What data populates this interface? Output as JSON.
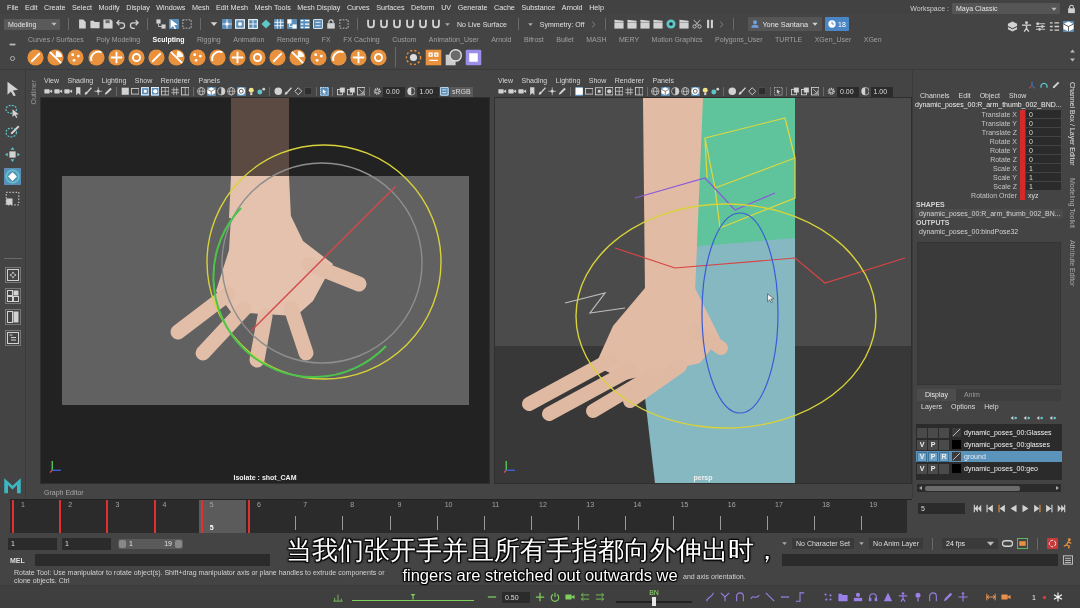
{
  "menu_bar": {
    "items": [
      "File",
      "Edit",
      "Create",
      "Select",
      "Modify",
      "Display",
      "Windows",
      "Mesh",
      "Edit Mesh",
      "Mesh Tools",
      "Mesh Display",
      "Curves",
      "Surfaces",
      "Deform",
      "UV",
      "Generate",
      "Cache",
      "Substance",
      "Arnold",
      "Help"
    ],
    "workspace_label": "Workspace :",
    "workspace": "Maya Classic"
  },
  "status_line": {
    "menu_set": "Modeling",
    "buttons": [
      {
        "on": false
      },
      {
        "on": false
      },
      {
        "on": false
      },
      {
        "on": false
      },
      {
        "on": false
      },
      {
        "on": false
      },
      {
        "on": true
      },
      {
        "on": false
      },
      {
        "on": true
      },
      {
        "on": true
      },
      {
        "on": true
      },
      {
        "on": false
      },
      {
        "on": true
      },
      {
        "on": true
      },
      {
        "on": true
      },
      {
        "on": true
      },
      {
        "on": false
      },
      {
        "on": false
      },
      {
        "on": false
      },
      {
        "on": false
      },
      {
        "on": false
      },
      {
        "on": false
      },
      {
        "on": false
      },
      {
        "on": false
      }
    ],
    "live_surface": "No Live Surface",
    "symmetry": "Symmetry: Off",
    "user": "Yone Santana",
    "notifications": "18",
    "panel_buttons": [
      {
        "on": false
      },
      {
        "on": false
      },
      {
        "on": false
      },
      {
        "on": false
      },
      {
        "on": true
      }
    ]
  },
  "shelf": {
    "tabs": [
      {
        "label": "Curves / Surfaces",
        "selected": false
      },
      {
        "label": "Poly Modeling",
        "selected": false
      },
      {
        "label": "Sculpting",
        "selected": true
      },
      {
        "label": "Rigging",
        "selected": false
      },
      {
        "label": "Animation",
        "selected": false
      },
      {
        "label": "Rendering",
        "selected": false
      },
      {
        "label": "FX",
        "selected": false
      },
      {
        "label": "FX Caching",
        "selected": false
      },
      {
        "label": "Custom",
        "selected": false
      },
      {
        "label": "Animation_User",
        "selected": false
      },
      {
        "label": "Arnold",
        "selected": false
      },
      {
        "label": "Bifrost",
        "selected": false
      },
      {
        "label": "Bullet",
        "selected": false
      },
      {
        "label": "MASH",
        "selected": false
      },
      {
        "label": "MERY",
        "selected": false
      },
      {
        "label": "Motion Graphics",
        "selected": false
      },
      {
        "label": "Polygons_User",
        "selected": false
      },
      {
        "label": "TURTLE",
        "selected": false
      },
      {
        "label": "XGen_User",
        "selected": false
      },
      {
        "label": "XGen",
        "selected": false
      }
    ]
  },
  "toolbox": {
    "tools": [
      {
        "selected": false
      },
      {
        "selected": false
      },
      {
        "selected": false
      },
      {
        "selected": false
      },
      {
        "selected": true
      },
      {
        "selected": false
      }
    ]
  },
  "outliner_tab": "Outliner",
  "viewports": [
    {
      "kind": "camera",
      "menu": [
        "View",
        "Shading",
        "Lighting",
        "Show",
        "Renderer",
        "Panels"
      ],
      "toolbar": [
        {
          "on": false
        },
        {
          "on": false
        },
        {
          "on": false
        },
        {
          "on": false
        },
        {
          "on": false
        },
        {
          "on": false
        },
        {
          "on": false
        },
        {
          "on": false
        },
        {
          "on": false
        },
        {
          "on": true
        },
        {
          "on": true
        },
        {
          "on": false
        },
        {
          "on": false
        },
        {
          "on": false
        },
        {
          "on": false
        },
        {
          "on": true
        },
        {
          "on": false
        },
        {
          "on": false
        },
        {
          "on": true
        },
        {
          "on": false
        },
        {
          "on": false
        },
        {
          "on": false
        },
        {
          "on": false
        },
        {
          "on": false
        },
        {
          "on": false
        },
        {
          "on": true
        },
        {
          "on": false
        },
        {
          "on": false
        },
        {
          "on": false
        },
        {
          "on": false
        },
        {
          "on": false
        },
        {
          "on": true
        }
      ],
      "exposure": "0.00",
      "gamma": "1.00",
      "color_space": "sRGB",
      "label": "Isolate : shot_CAM"
    },
    {
      "kind": "perspective",
      "menu": [
        "View",
        "Shading",
        "Lighting",
        "Show",
        "Renderer",
        "Panels"
      ],
      "toolbar": [
        {
          "on": false
        },
        {
          "on": false
        },
        {
          "on": false
        },
        {
          "on": false
        },
        {
          "on": false
        },
        {
          "on": false
        },
        {
          "on": false
        },
        {
          "on": true
        },
        {
          "on": false
        },
        {
          "on": false
        },
        {
          "on": false
        },
        {
          "on": false
        },
        {
          "on": false
        },
        {
          "on": false
        },
        {
          "on": false
        },
        {
          "on": true
        },
        {
          "on": false
        },
        {
          "on": false
        },
        {
          "on": true
        },
        {
          "on": false
        },
        {
          "on": false
        },
        {
          "on": false
        },
        {
          "on": false
        },
        {
          "on": false
        },
        {
          "on": false
        },
        {
          "on": false
        },
        {
          "on": false
        },
        {
          "on": false
        },
        {
          "on": false
        },
        {
          "on": false
        },
        {
          "on": false
        }
      ],
      "exposure": "0.00",
      "gamma": "1.00",
      "label": "persp"
    }
  ],
  "graph_editor_label": "Graph Editor",
  "channel_box": {
    "menu": [
      "Channels",
      "Edit",
      "Object",
      "Show"
    ],
    "node": "dynamic_poses_00:R_arm_thumb_002_BND...",
    "channels": [
      {
        "kind": "number",
        "label": "Translate X",
        "value": "0",
        "keyed": true
      },
      {
        "kind": "number",
        "label": "Translate Y",
        "value": "0",
        "keyed": true
      },
      {
        "kind": "number",
        "label": "Translate Z",
        "value": "0",
        "keyed": true
      },
      {
        "kind": "number",
        "label": "Rotate X",
        "value": "0",
        "keyed": true
      },
      {
        "kind": "number",
        "label": "Rotate Y",
        "value": "0",
        "keyed": true
      },
      {
        "kind": "number",
        "label": "Rotate Z",
        "value": "0",
        "keyed": true
      },
      {
        "kind": "number",
        "label": "Scale X",
        "value": "1",
        "keyed": true
      },
      {
        "kind": "number",
        "label": "Scale Y",
        "value": "1",
        "keyed": true
      },
      {
        "kind": "number",
        "label": "Scale Z",
        "value": "1",
        "keyed": true
      },
      {
        "kind": "enum",
        "label": "Rotation Order",
        "value": "xyz",
        "keyed": true
      }
    ],
    "shapes_heading": "SHAPES",
    "shapes": [
      "dynamic_poses_00:R_arm_thumb_002_BN..."
    ],
    "outputs_heading": "OUTPUTS",
    "outputs": [
      "dynamic_poses_00:bindPose32"
    ]
  },
  "layer_editor": {
    "tabs": [
      {
        "label": "Display",
        "selected": true
      },
      {
        "label": "Anim",
        "selected": false
      }
    ],
    "menu": [
      "Layers",
      "Options",
      "Help"
    ],
    "layers": [
      {
        "name": "dynamic_poses_00:Glasses",
        "selected": false
      },
      {
        "toggles": [
          "V",
          "P"
        ],
        "color": "#000000",
        "name": "dynamic_poses_00:glasses",
        "selected": false
      },
      {
        "toggles": [
          "V",
          "P",
          "R"
        ],
        "name": "ground",
        "selected": true
      },
      {
        "toggles": [
          "V",
          "P"
        ],
        "color": "#000000",
        "name": "dynamic_poses_00:geo",
        "selected": false
      }
    ]
  },
  "side_tabs": [
    {
      "label": "Channel Box / Layer Editor",
      "selected": true
    },
    {
      "label": "Modeling Toolkit",
      "selected": false
    },
    {
      "label": "Attribute Editor",
      "selected": false
    }
  ],
  "time_slider": {
    "frames": [
      {
        "label": "1",
        "key": true,
        "selected": false
      },
      {
        "label": "2",
        "key": true,
        "selected": false
      },
      {
        "label": "3",
        "key": true,
        "selected": false
      },
      {
        "label": "4",
        "key": true,
        "selected": false
      },
      {
        "label": "5",
        "key": true,
        "selected": true
      },
      {
        "label": "6",
        "key": true,
        "selected": false
      },
      {
        "label": "7",
        "key": false,
        "selected": false
      },
      {
        "label": "8",
        "key": false,
        "selected": false
      },
      {
        "label": "9",
        "key": false,
        "selected": false
      },
      {
        "label": "10",
        "key": false,
        "selected": false
      },
      {
        "label": "11",
        "key": false,
        "selected": false
      },
      {
        "label": "12",
        "key": false,
        "selected": false
      },
      {
        "label": "13",
        "key": false,
        "selected": false
      },
      {
        "label": "14",
        "key": false,
        "selected": false
      },
      {
        "label": "15",
        "key": false,
        "selected": false
      },
      {
        "label": "16",
        "key": false,
        "selected": false
      },
      {
        "label": "17",
        "key": false,
        "selected": false
      },
      {
        "label": "18",
        "key": false,
        "selected": false
      },
      {
        "label": "19",
        "key": false,
        "selected": false
      }
    ],
    "current_frame_marker": "5",
    "current_frame": "5"
  },
  "range_slider": {
    "start_time": "1",
    "range_start": "1",
    "level": 1,
    "slider_start": "1",
    "slider_end": "19",
    "character_set": "No Character Set",
    "anim_layer": "No Anim Layer",
    "fps": "24 fps"
  },
  "command_line": {
    "language": "MEL"
  },
  "help_line": {
    "text_before_caption": "Rotate Tool: Use manipulator to rotate object(s). Shift+drag manipulator axis or plane handles to extrude components or clone objects. Ctrl",
    "text_after_caption": "and axis orientation."
  },
  "bottom_shelf": {
    "tween_slider": {
      "level": 0.5
    },
    "value": "0.50",
    "bn_slider": {
      "label": "BN",
      "level": 0.5
    },
    "count": "1"
  },
  "caption": {
    "chinese": "当我们张开手并且所有手指都向外伸出时，",
    "english": "fingers are stretched out outwards we"
  }
}
